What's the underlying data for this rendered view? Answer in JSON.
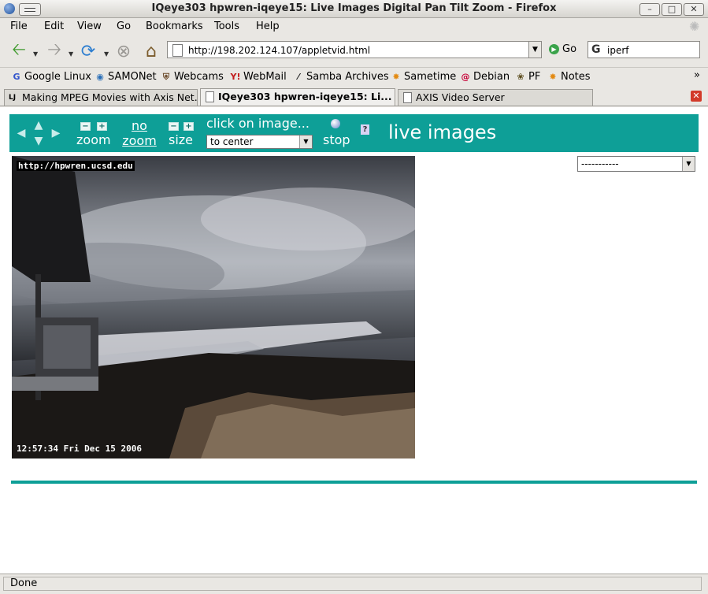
{
  "window": {
    "title": "IQeye303 hpwren-iqeye15: Live Images Digital Pan Tilt Zoom - Firefox"
  },
  "menubar": {
    "items": [
      {
        "label": "File"
      },
      {
        "label": "Edit"
      },
      {
        "label": "View"
      },
      {
        "label": "Go"
      },
      {
        "label": "Bookmarks"
      },
      {
        "label": "Tools"
      },
      {
        "label": "Help"
      }
    ]
  },
  "navbar": {
    "url": "http://198.202.124.107/appletvid.html",
    "go_label": "Go",
    "search_value": "iperf"
  },
  "bookmarks": [
    {
      "label": "Google Linux",
      "icon": "google-icon"
    },
    {
      "label": "SAMONet",
      "icon": "drop-icon"
    },
    {
      "label": "Webcams",
      "icon": "shield-icon"
    },
    {
      "label": "WebMail",
      "icon": "yahoo-icon"
    },
    {
      "label": "Samba Archives",
      "icon": "samba-icon"
    },
    {
      "label": "Sametime",
      "icon": "sametime-icon"
    },
    {
      "label": "Debian",
      "icon": "debian-icon"
    },
    {
      "label": "PF",
      "icon": "pf-icon"
    },
    {
      "label": "Notes",
      "icon": "notes-icon"
    }
  ],
  "tabs": [
    {
      "label": "Making MPEG Movies with Axis Net...",
      "icon": "lj-icon",
      "active": false
    },
    {
      "label": "IQeye303 hpwren-iqeye15: Li...",
      "icon": "page-icon",
      "active": true
    },
    {
      "label": "AXIS Video Server",
      "icon": "page-icon",
      "active": false
    }
  ],
  "camera_controls": {
    "zoom_label": "zoom",
    "no_zoom_line1": "no",
    "no_zoom_line2": "zoom",
    "size_label": "size",
    "click_label": "click on image...",
    "click_select_value": "to center",
    "stop_label": "stop",
    "help_label": "?",
    "live_label": "live images"
  },
  "camera_image": {
    "url_overlay": "http://hpwren.ucsd.edu",
    "timestamp_overlay": "12:57:34 Fri Dec 15 2006"
  },
  "right_select": {
    "value": "-----------"
  },
  "status": {
    "text": "Done"
  }
}
